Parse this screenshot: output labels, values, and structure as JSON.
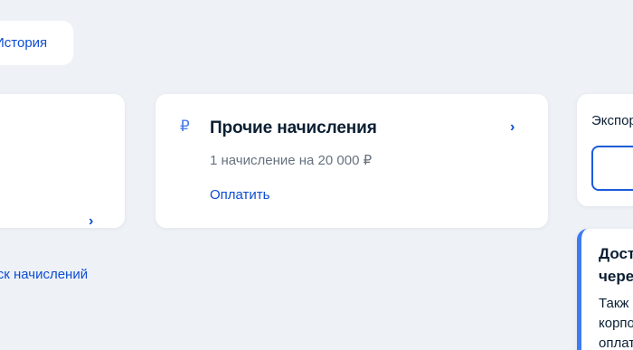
{
  "history": {
    "label": "История"
  },
  "main_card": {
    "icon": "₽",
    "title": "Прочие начисления",
    "subtitle": "1 начисление на 20 000 ₽",
    "pay_label": "Оплатить",
    "chevron": "›"
  },
  "left_card": {
    "chevron": "›"
  },
  "search_link": {
    "label": "оиск начислений"
  },
  "export_card": {
    "label": "Экспор"
  },
  "notice_card": {
    "title_lines": [
      "Дост",
      "чере"
    ],
    "body_lines": [
      "Такж",
      "корпо",
      "оплат"
    ]
  },
  "colors": {
    "background": "#eef2f7",
    "link": "#0d4cd3",
    "accent": "#3f7bf0",
    "text": "#0b1f33",
    "muted": "#66727f"
  },
  "icons": {
    "ruble": "ruble-icon",
    "chevron": "chevron-right-icon"
  }
}
